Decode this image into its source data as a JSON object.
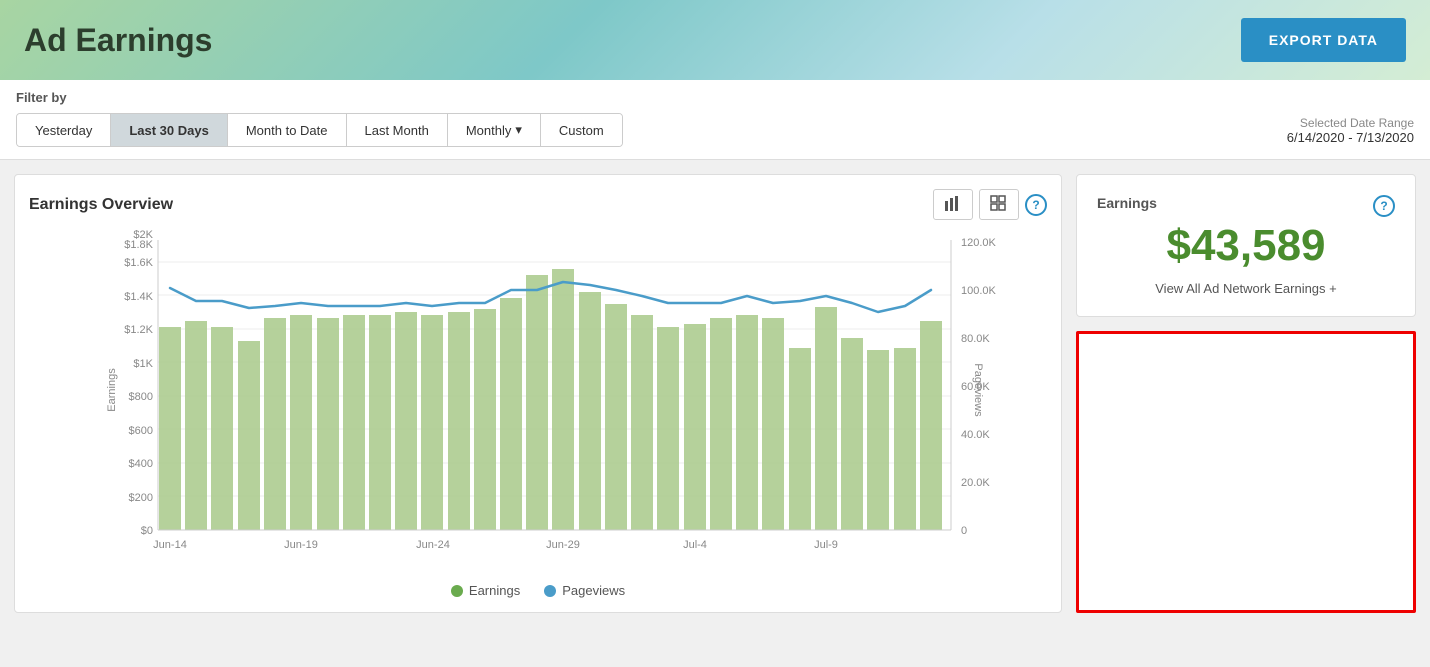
{
  "header": {
    "title": "Ad Earnings",
    "export_button": "EXPORT DATA"
  },
  "filter": {
    "label": "Filter by",
    "buttons": [
      {
        "id": "yesterday",
        "label": "Yesterday",
        "active": false
      },
      {
        "id": "last30days",
        "label": "Last 30 Days",
        "active": true
      },
      {
        "id": "monthtodate",
        "label": "Month to Date",
        "active": false
      },
      {
        "id": "lastmonth",
        "label": "Last Month",
        "active": false
      },
      {
        "id": "monthly",
        "label": "Monthly",
        "active": false,
        "has_dropdown": true
      },
      {
        "id": "custom",
        "label": "Custom",
        "active": false
      }
    ],
    "date_range_label": "Selected Date Range",
    "date_range_value": "6/14/2020 - 7/13/2020"
  },
  "chart": {
    "title": "Earnings Overview",
    "help_icon": "?",
    "view_bar_icon": "▦",
    "view_grid_icon": "⊞",
    "x_labels": [
      "Jun-14",
      "Jun-19",
      "Jun-24",
      "Jun-29",
      "Jul-4",
      "Jul-9"
    ],
    "y_earnings_labels": [
      "$0",
      "$200",
      "$400",
      "$600",
      "$800",
      "$1K",
      "$1.2K",
      "$1.4K",
      "$1.6K",
      "$1.8K",
      "$2K"
    ],
    "y_pageviews_labels": [
      "0",
      "20.0K",
      "40.0K",
      "60.0K",
      "80.0K",
      "100.0K",
      "120.0K"
    ],
    "legend_earnings": "Earnings",
    "legend_pageviews": "Pageviews",
    "bars": [
      {
        "x": 1,
        "h": 0.7
      },
      {
        "x": 2,
        "h": 0.72
      },
      {
        "x": 3,
        "h": 0.7
      },
      {
        "x": 4,
        "h": 0.65
      },
      {
        "x": 5,
        "h": 0.73
      },
      {
        "x": 6,
        "h": 0.74
      },
      {
        "x": 7,
        "h": 0.73
      },
      {
        "x": 8,
        "h": 0.74
      },
      {
        "x": 9,
        "h": 0.74
      },
      {
        "x": 10,
        "h": 0.75
      },
      {
        "x": 11,
        "h": 0.74
      },
      {
        "x": 12,
        "h": 0.75
      },
      {
        "x": 13,
        "h": 0.76
      },
      {
        "x": 14,
        "h": 0.8
      },
      {
        "x": 15,
        "h": 0.88
      },
      {
        "x": 16,
        "h": 0.9
      },
      {
        "x": 17,
        "h": 0.82
      },
      {
        "x": 18,
        "h": 0.78
      },
      {
        "x": 19,
        "h": 0.74
      },
      {
        "x": 20,
        "h": 0.7
      },
      {
        "x": 21,
        "h": 0.71
      },
      {
        "x": 22,
        "h": 0.73
      },
      {
        "x": 23,
        "h": 0.74
      },
      {
        "x": 24,
        "h": 0.73
      },
      {
        "x": 25,
        "h": 0.63
      },
      {
        "x": 26,
        "h": 0.78
      },
      {
        "x": 27,
        "h": 0.66
      },
      {
        "x": 28,
        "h": 0.62
      },
      {
        "x": 29,
        "h": 0.62
      },
      {
        "x": 30,
        "h": 0.72
      }
    ]
  },
  "earnings_card": {
    "title": "Earnings",
    "amount": "$43,589",
    "link_text": "View All Ad Network Earnings +"
  },
  "ad_box": {}
}
